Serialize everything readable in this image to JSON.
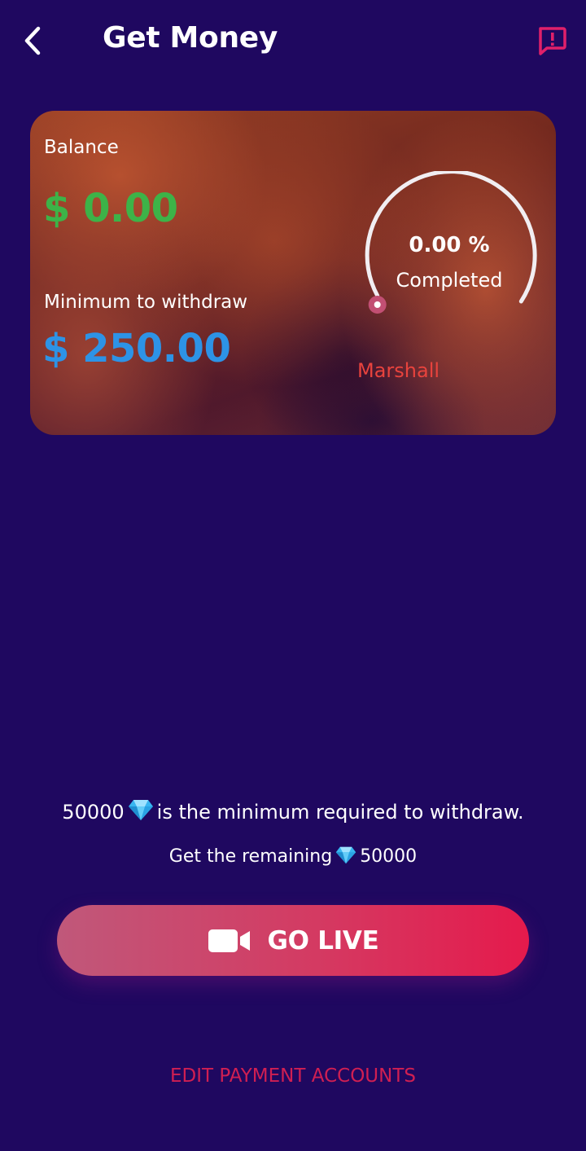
{
  "header": {
    "title": "Get Money",
    "back_icon": "chevron-left-icon",
    "report_icon": "report-flag-icon"
  },
  "card": {
    "balance_label": "Balance",
    "balance_value": "$ 0.00",
    "minimum_label": "Minimum to withdraw",
    "minimum_value": "$ 250.00",
    "progress_percent": "0.00 %",
    "progress_fraction": 0,
    "progress_caption": "Completed",
    "username": "Marshall"
  },
  "info": {
    "min_amount": "50000",
    "min_text": "is the minimum required to withdraw.",
    "remaining_text": "Get the remaining",
    "remaining_amount": "50000",
    "gem_icon": "diamond-icon"
  },
  "actions": {
    "go_live_label": "GO LIVE",
    "go_live_icon": "video-camera-icon",
    "edit_payment_label": "EDIT PAYMENT ACCOUNTS"
  },
  "colors": {
    "background": "#1f0860",
    "balance_green": "#3db348",
    "minimum_blue": "#2d93e6",
    "accent_red": "#e51a4c",
    "username_red": "#e8433d"
  }
}
